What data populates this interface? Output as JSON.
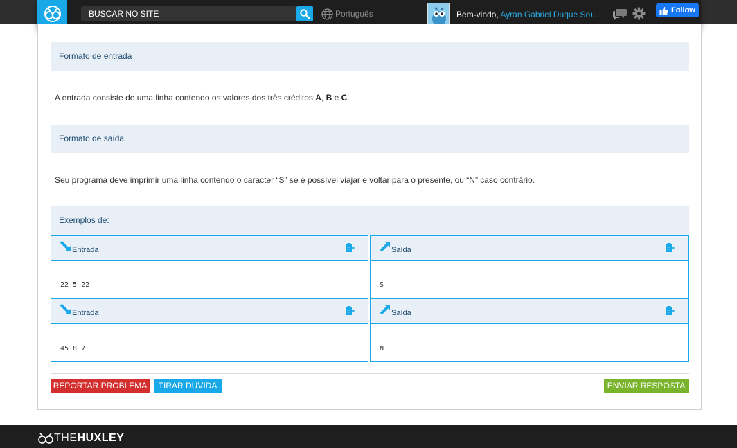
{
  "header": {
    "search_placeholder": "BUSCAR NO SITE",
    "language": "Português",
    "welcome_prefix": "Bem-vindo, ",
    "username": "Ayran Gabriel Duque Sou...",
    "follow_label": "Follow",
    "accent_color": "#1aa9e8"
  },
  "sections": {
    "input_format": {
      "title": "Formato de entrada",
      "text_before": "A entrada consiste de uma linha contendo os valores dos três créditos ",
      "a": "A",
      "sep1": ", ",
      "b": "B",
      "sep2": " e ",
      "c": "C",
      "end": "."
    },
    "output_format": {
      "title": "Formato de saída",
      "text": "Seu programa deve imprimir uma linha contendo o caracter “S” se é possível viajar e voltar para o presente, ou “N” caso contrário."
    },
    "examples": {
      "title": "Exemplos de:",
      "input_label": "Entrada",
      "output_label": "Saída",
      "items": [
        {
          "input": "22 5 22",
          "output": "S"
        },
        {
          "input": "45 8 7",
          "output": "N"
        }
      ]
    }
  },
  "actions": {
    "report": "REPORTAR PROBLEMA",
    "doubt": "TIRAR DÚVIDA",
    "submit": "ENVIAR RESPOSTA"
  },
  "footer": {
    "brand_thin": "THE",
    "brand_bold": "HUXLEY"
  },
  "icons": [
    "logo-icon",
    "search-icon",
    "globe-icon",
    "user-avatar",
    "chat-icon",
    "gear-icon",
    "thumbs-up-icon",
    "arrow-in-icon",
    "arrow-out-icon",
    "copy-icon"
  ]
}
